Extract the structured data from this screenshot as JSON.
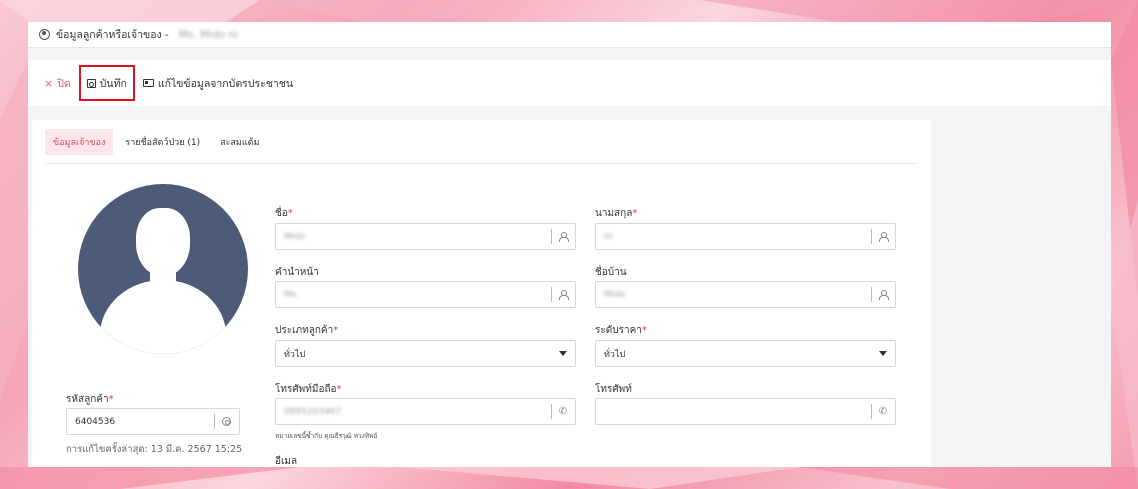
{
  "window": {
    "title": "ข้อมูลลูกค้าหรือเจ้าของ -",
    "title_name": "Ms. Mido ni"
  },
  "toolbar": {
    "close_label": "ปิด",
    "save_label": "บันทึก",
    "idcard_label": "แก้ไขข้อมูลจากบัตรประชาชน"
  },
  "tabs": [
    {
      "label": "ข้อมูลเจ้าของ",
      "active": true
    },
    {
      "label": "รายชื่อสัตว์ป่วย (1)",
      "active": false
    },
    {
      "label": "สะสมแต้ม",
      "active": false
    }
  ],
  "form": {
    "first_name": {
      "label": "ชื่อ",
      "value": "Mido"
    },
    "last_name": {
      "label": "นามสกุล",
      "value": "ni"
    },
    "prefix": {
      "label": "คำนำหน้า",
      "value": "Ms."
    },
    "nickname": {
      "label": "ชื่อบ้าน",
      "value": "Mido"
    },
    "customer_type": {
      "label": "ประเภทลูกค้า",
      "value": "ทั่วไป"
    },
    "price_level": {
      "label": "ระดับราคา",
      "value": "ทั่วไป"
    },
    "mobile": {
      "label": "โทรศัพท์มือถือ",
      "value": "0895203467",
      "hint": "หมายเลขนี้ซ้ำกับ คุณธีรวุฒิ ทวงทิพย์"
    },
    "phone": {
      "label": "โทรศัพท์",
      "value": ""
    },
    "email": {
      "label": "อีเมล",
      "value": ""
    },
    "customer_code": {
      "label": "รหัสลูกค้า",
      "value": "6404536"
    },
    "last_edit": "การแก้ไขครั้งล่าสุด: 13 มี.ค. 2567 15:25"
  },
  "colors": {
    "accent": "#d94c63",
    "required": "#e0334a",
    "highlight_box": "#e01020",
    "avatar_bg": "#4d5a78"
  },
  "icons": {
    "title": "user-circle-icon",
    "close": "close-icon",
    "save": "save-icon",
    "idcard": "id-card-icon",
    "user": "user-icon",
    "phone": "phone-icon",
    "email": "mail-icon",
    "code": "settings-icon",
    "dropdown": "chevron-down-icon"
  }
}
